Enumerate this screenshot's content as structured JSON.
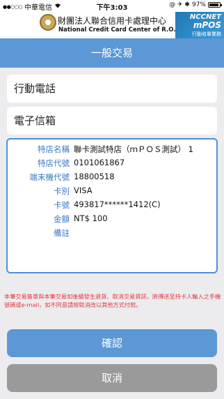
{
  "status_bar": {
    "signal": "●●○○○",
    "carrier": "中華電信",
    "wifi": "wifi-icon",
    "time": "下午3:03",
    "icons": "@ ✈ ✱",
    "battery_pct": "97%"
  },
  "banner": {
    "org_name_cn": "財團法人聯合信用卡處理中心",
    "org_name_en": "National Credit Card Center of R.O.C.",
    "brand_top": "NCCNET",
    "brand_mid": "mPOS",
    "brand_sub": "行動收單業務"
  },
  "navbar": {
    "title": "一般交易"
  },
  "form": {
    "phone_label": "行動電話",
    "email_label": "電子信箱"
  },
  "transaction": {
    "rows": [
      {
        "label": "特店名稱",
        "value": "聯卡測試特店（ｍＰＯＳ測試） 1"
      },
      {
        "label": "特店代號",
        "value": "0101061867"
      },
      {
        "label": "端末機代號",
        "value": "18800518"
      },
      {
        "label": "卡別",
        "value": "VISA"
      },
      {
        "label": "卡號",
        "value": "493817******1412(C)"
      },
      {
        "label": "金額",
        "value": "NT$ 100"
      },
      {
        "label": "備註",
        "value": ""
      }
    ]
  },
  "notice": "本筆交易簽單與本筆交易如後續發生退貨、取消交易資訊，將傳送至持卡人輸入之手機號碼或e-mail，如不同意請按取消改以其他方式付款。",
  "buttons": {
    "confirm": "確認",
    "cancel": "取消"
  },
  "colors": {
    "accent": "#5c97d6",
    "label_blue": "#3a78c2",
    "notice_red": "#e0393a",
    "cancel_gray": "#9a9a9a"
  }
}
